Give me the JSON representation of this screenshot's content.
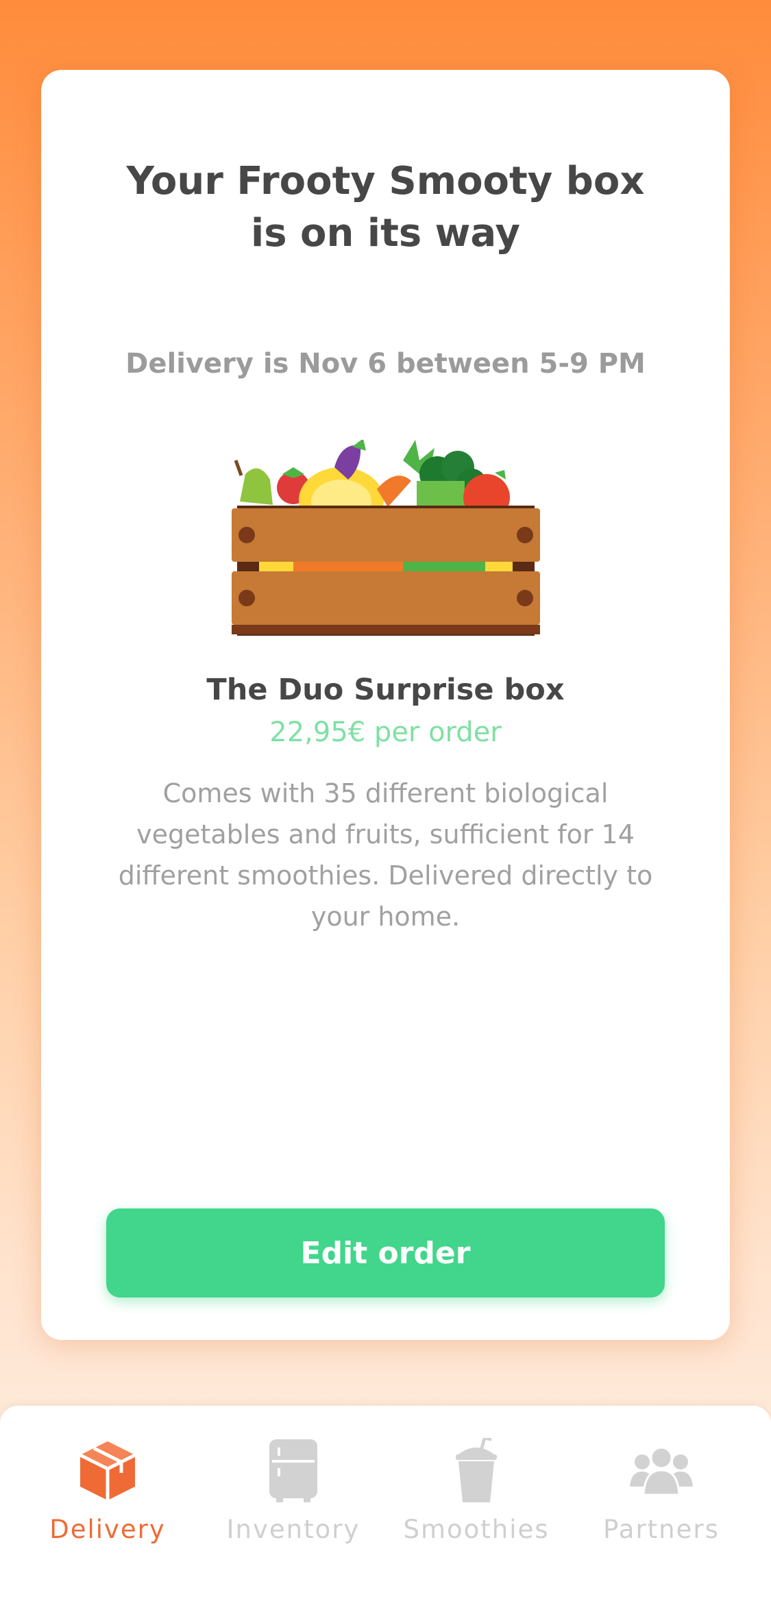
{
  "card": {
    "title": "Your Frooty Smooty box is on its way",
    "delivery_info": "Delivery is Nov 6 between 5-9 PM",
    "box_name": "The Duo Surprise box",
    "box_price": "22,95€ per order",
    "box_description": "Comes with 35 different biological vegetables and fruits, sufficient for 14 different smoothies.  Delivered directly to your home.",
    "edit_button_label": "Edit order"
  },
  "tabbar": {
    "tabs": [
      {
        "label": "Delivery",
        "icon": "box-icon",
        "active": true
      },
      {
        "label": "Inventory",
        "icon": "fridge-icon",
        "active": false
      },
      {
        "label": "Smoothies",
        "icon": "smoothie-cup-icon",
        "active": false
      },
      {
        "label": "Partners",
        "icon": "people-icon",
        "active": false
      }
    ]
  },
  "colors": {
    "accent_orange": "#f06a35",
    "button_green": "#41d68b",
    "price_green": "#7fe0a3",
    "inactive_gray": "#cfcfcf"
  }
}
